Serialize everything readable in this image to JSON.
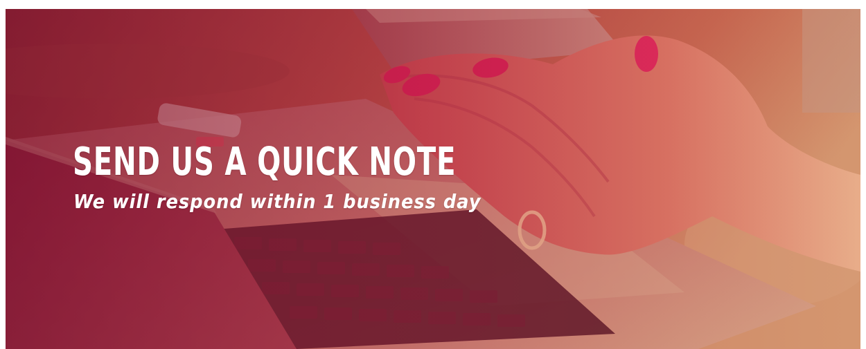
{
  "hero": {
    "title": "SEND US A QUICK NOTE",
    "subtitle": "We will respond within 1 business day",
    "background_image": "laptop-and-phone-in-hand-photo",
    "overlay_color": "#b3203f",
    "text_color": "#ffffff"
  }
}
